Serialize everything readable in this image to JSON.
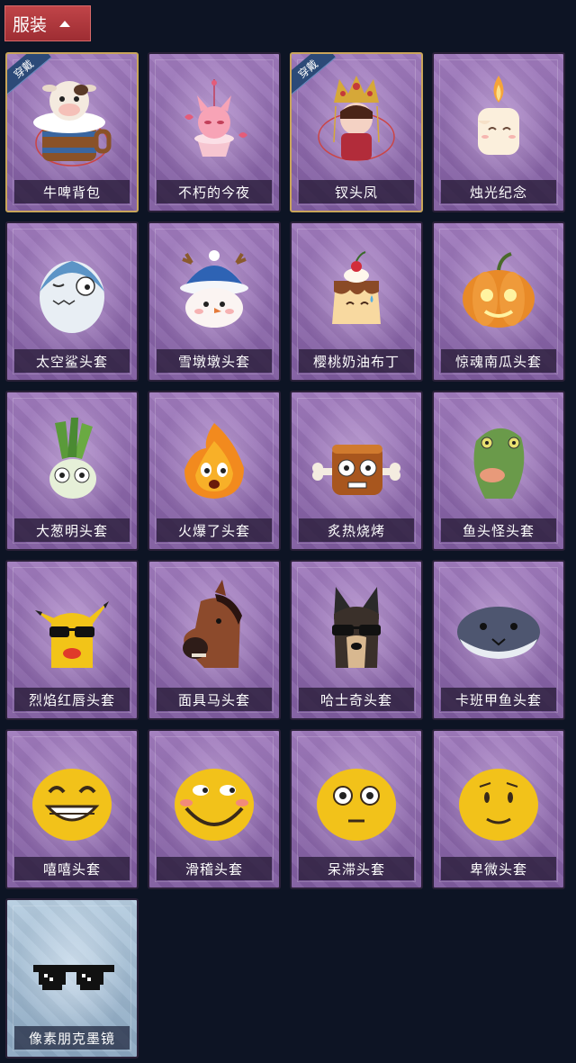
{
  "section": {
    "title": "服装"
  },
  "badge_text": "穿戴",
  "items": [
    {
      "label": "牛啤背包",
      "equipped": true,
      "icon": "cow-beer-backpack-icon"
    },
    {
      "label": "不朽的今夜",
      "equipped": false,
      "icon": "pink-fox-icon"
    },
    {
      "label": "钗头凤",
      "equipped": true,
      "icon": "phoenix-crown-icon"
    },
    {
      "label": "烛光纪念",
      "equipped": false,
      "icon": "candle-icon"
    },
    {
      "label": "太空鲨头套",
      "equipped": false,
      "icon": "shark-head-icon"
    },
    {
      "label": "雪墩墩头套",
      "equipped": false,
      "icon": "snowman-head-icon"
    },
    {
      "label": "樱桃奶油布丁",
      "equipped": false,
      "icon": "pudding-icon"
    },
    {
      "label": "惊魂南瓜头套",
      "equipped": false,
      "icon": "pumpkin-head-icon"
    },
    {
      "label": "大葱明头套",
      "equipped": false,
      "icon": "scallion-head-icon"
    },
    {
      "label": "火爆了头套",
      "equipped": false,
      "icon": "fire-head-icon"
    },
    {
      "label": "炙热烧烤",
      "equipped": false,
      "icon": "bbq-meat-icon"
    },
    {
      "label": "鱼头怪头套",
      "equipped": false,
      "icon": "fish-head-icon"
    },
    {
      "label": "烈焰红唇头套",
      "equipped": false,
      "icon": "yellow-mask-sunglasses-icon"
    },
    {
      "label": "面具马头套",
      "equipped": false,
      "icon": "horse-mask-icon"
    },
    {
      "label": "哈士奇头套",
      "equipped": false,
      "icon": "husky-head-icon"
    },
    {
      "label": "卡班甲鱼头套",
      "equipped": false,
      "icon": "flatfish-head-icon"
    },
    {
      "label": "嘻嘻头套",
      "equipped": false,
      "icon": "grin-emoji-icon"
    },
    {
      "label": "滑稽头套",
      "equipped": false,
      "icon": "funny-emoji-icon"
    },
    {
      "label": "呆滞头套",
      "equipped": false,
      "icon": "stunned-emoji-icon"
    },
    {
      "label": "卑微头套",
      "equipped": false,
      "icon": "humble-emoji-icon"
    },
    {
      "label": "像素朋克墨镜",
      "equipped": false,
      "icon": "pixel-sunglasses-icon",
      "rarity": "blue"
    }
  ]
}
